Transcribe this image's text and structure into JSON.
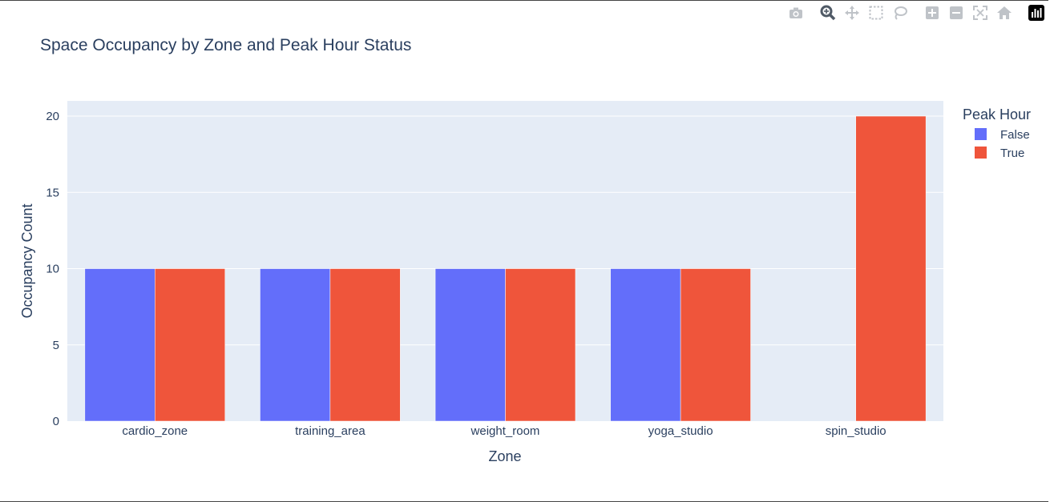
{
  "chart_data": {
    "type": "bar",
    "title": "Space Occupancy by Zone and Peak Hour Status",
    "xlabel": "Zone",
    "ylabel": "Occupancy Count",
    "categories": [
      "cardio_zone",
      "training_area",
      "weight_room",
      "yoga_studio",
      "spin_studio"
    ],
    "series": [
      {
        "name": "False",
        "color": "#636efa",
        "values": [
          10,
          10,
          10,
          10,
          null
        ]
      },
      {
        "name": "True",
        "color": "#ef553b",
        "values": [
          10,
          10,
          10,
          10,
          20
        ]
      }
    ],
    "ylim": [
      0,
      21
    ],
    "yticks": [
      0,
      5,
      10,
      15,
      20
    ],
    "grid": true,
    "legend": {
      "title": "Peak Hour",
      "placement": "top-right"
    },
    "plot_background": "#e5ecf6"
  },
  "modebar": {
    "icons": [
      "camera-icon",
      "zoom-icon",
      "pan-icon",
      "box-select-icon",
      "lasso-icon",
      "zoom-in-icon",
      "zoom-out-icon",
      "autoscale-icon",
      "home-icon",
      "plotly-logo-icon"
    ]
  }
}
